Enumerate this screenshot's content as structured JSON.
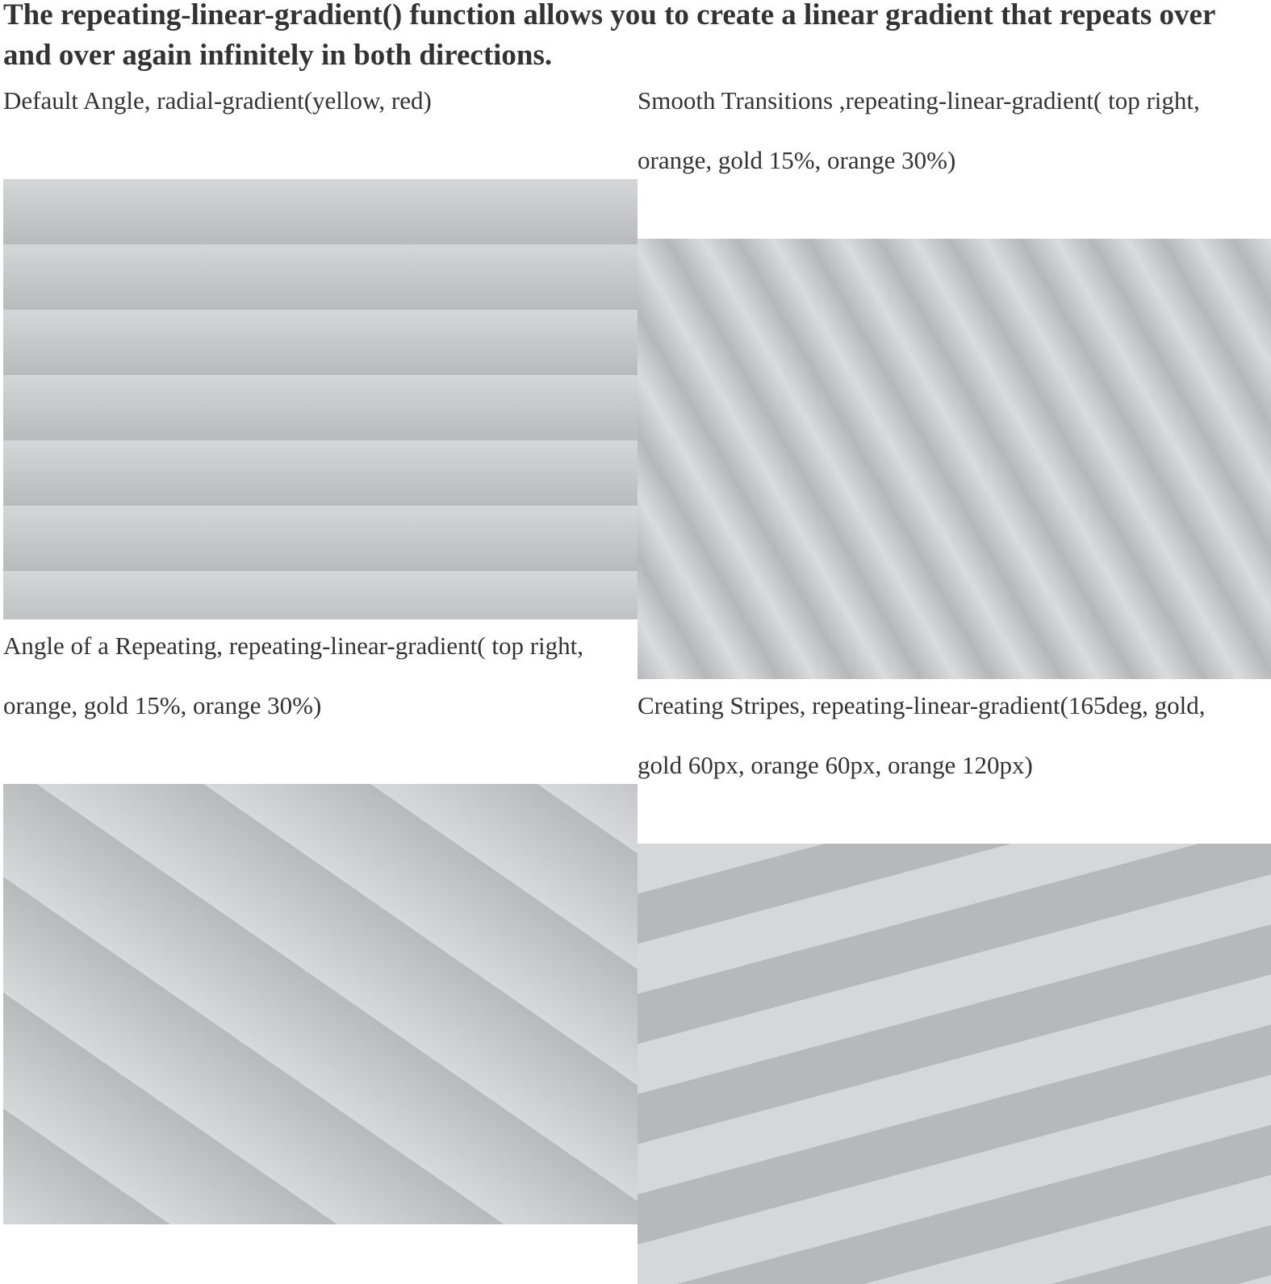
{
  "page": {
    "title": "The repeating-linear-gradient() function allows you to create a linear gradient that repeats over and over again infinitely in both directions."
  },
  "examples": [
    {
      "caption": "Default Angle, radial-gradient(yellow, red)",
      "pattern": "horizontal repeating bands"
    },
    {
      "caption": "Smooth Transitions ,repeating-linear-gradient( top right, orange, gold 15%, orange 30%)",
      "pattern": "smooth diagonal bands"
    },
    {
      "caption": "Angle of a Repeating, repeating-linear-gradient( top right, orange, gold 15%, orange 30%)",
      "pattern": "angled repeating bands"
    },
    {
      "caption": "Creating Stripes, repeating-linear-gradient(165deg, gold, gold 60px, orange 60px, orange 120px)",
      "pattern": "hard stripes"
    }
  ],
  "colors": {
    "text": "#333333",
    "background": "#ffffff",
    "swatch_light": "#d6d7d9",
    "swatch_dark": "#b8b9bb"
  }
}
